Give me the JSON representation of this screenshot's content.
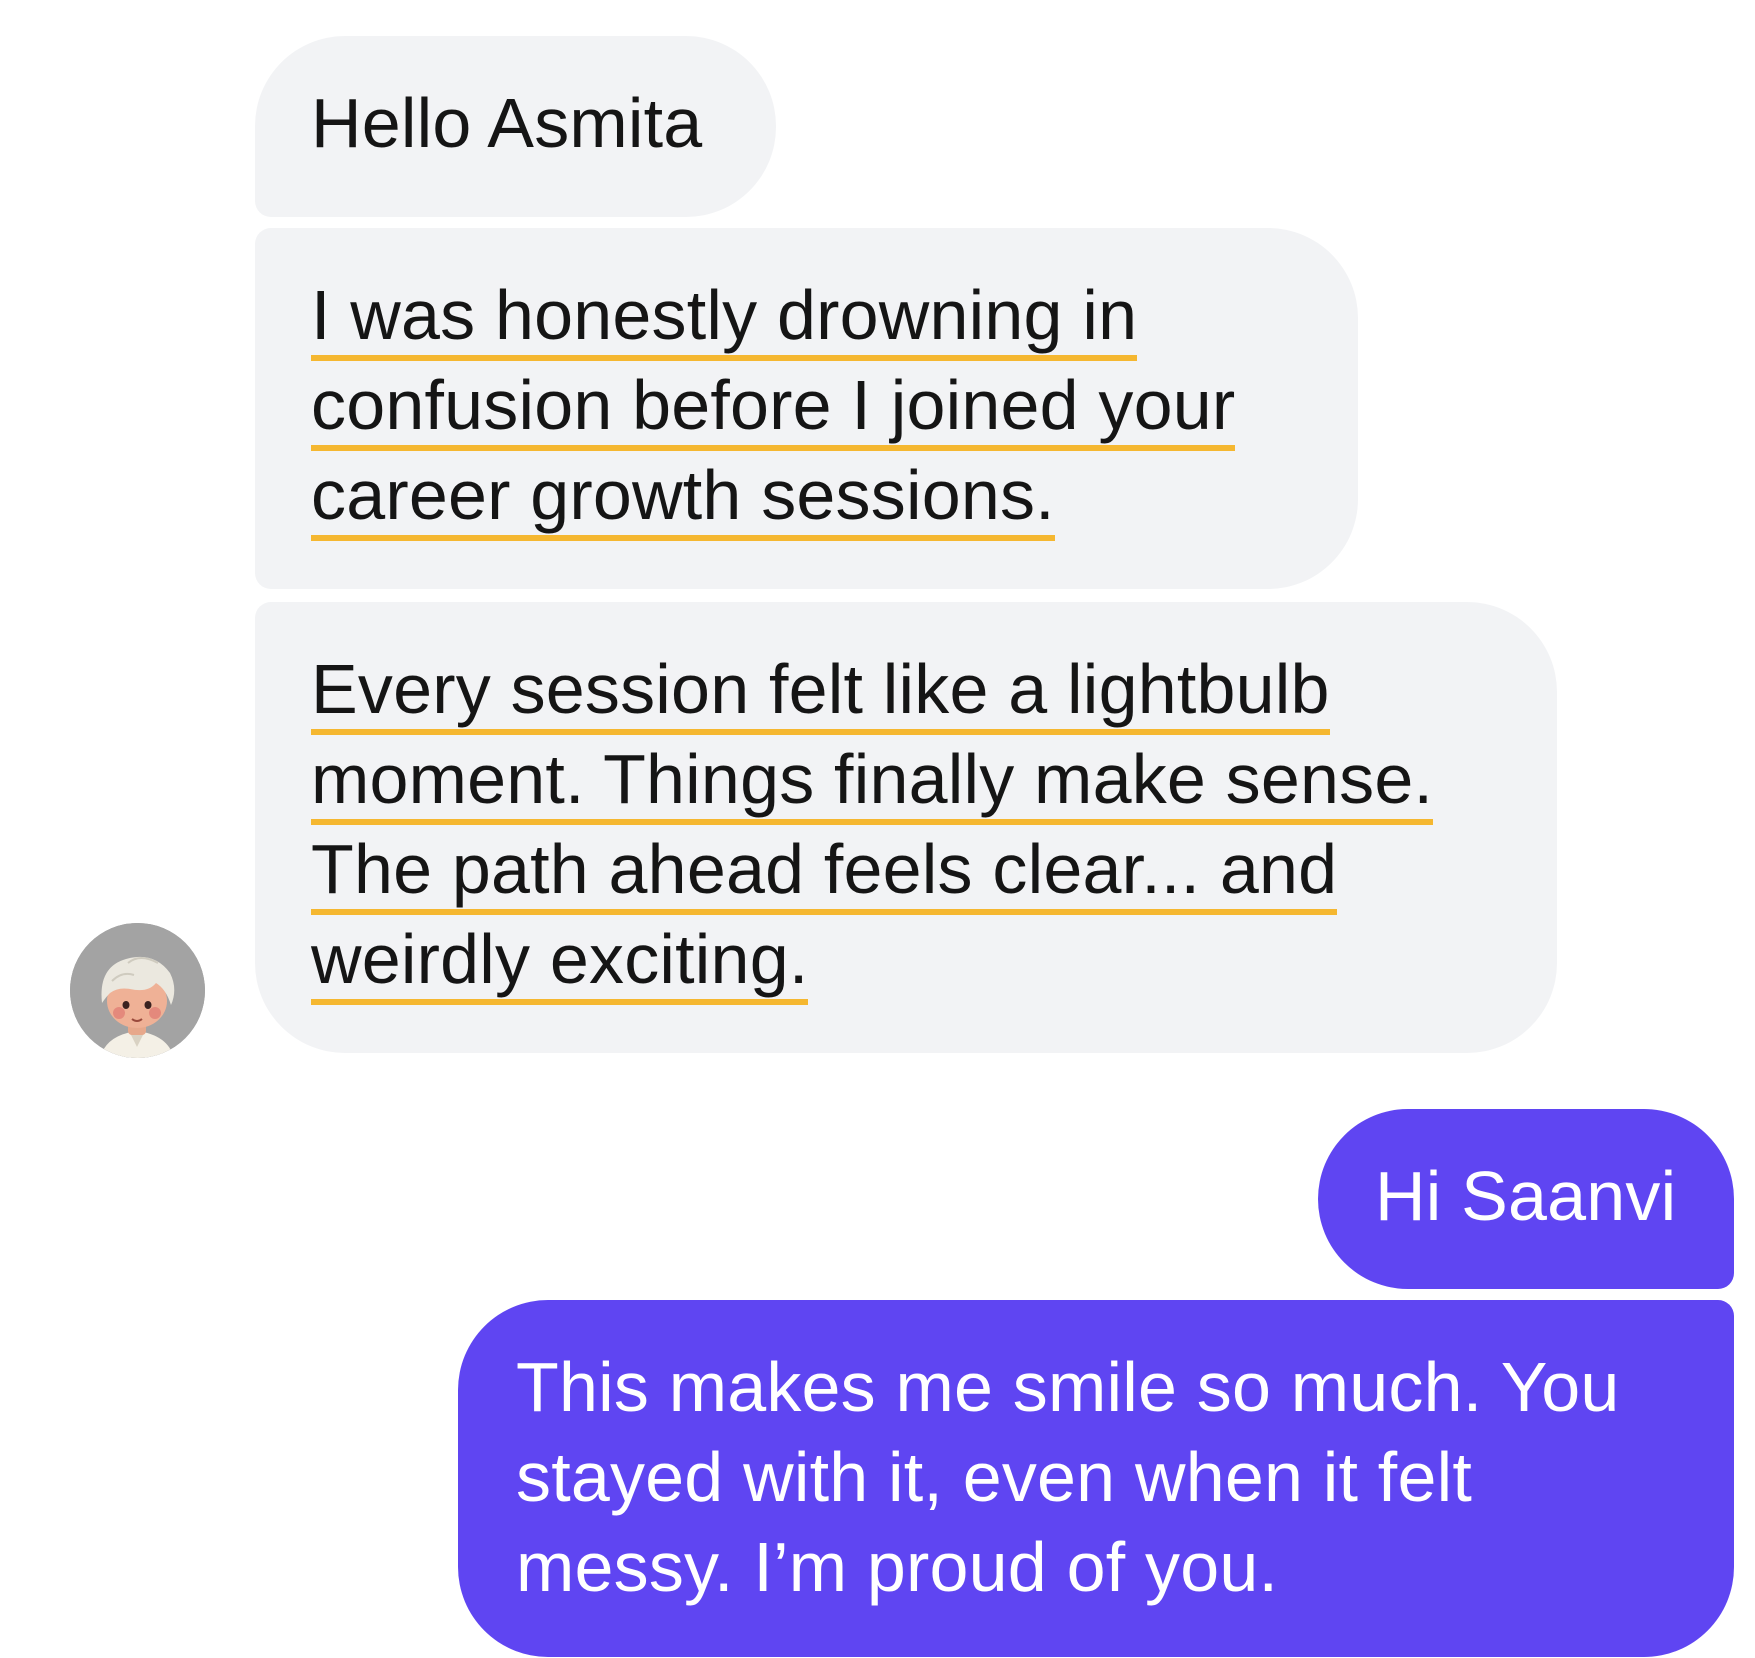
{
  "conversation": {
    "incoming": {
      "avatar_icon": "user-avatar-icon",
      "messages": [
        {
          "lines": [
            "Hello Asmita"
          ]
        },
        {
          "lines": [
            "I was honestly drowning in",
            "confusion before I joined your",
            "career growth sessions."
          ]
        },
        {
          "lines": [
            "Every session felt like a lightbulb",
            "moment. Things finally make sense.",
            "The path ahead feels clear... and",
            "weirdly exciting."
          ]
        }
      ]
    },
    "outgoing": {
      "messages": [
        {
          "lines": [
            "Hi Saanvi"
          ]
        },
        {
          "lines": [
            "This makes me smile so much. You",
            "stayed with it, even when it felt",
            "messy. I’m proud of you."
          ]
        }
      ]
    }
  },
  "colors": {
    "incoming_bubble": "#f2f3f5",
    "outgoing_bubble": "#5f45f2",
    "highlight_underline": "#f5b730",
    "avatar_background": "#a3a3a3"
  }
}
